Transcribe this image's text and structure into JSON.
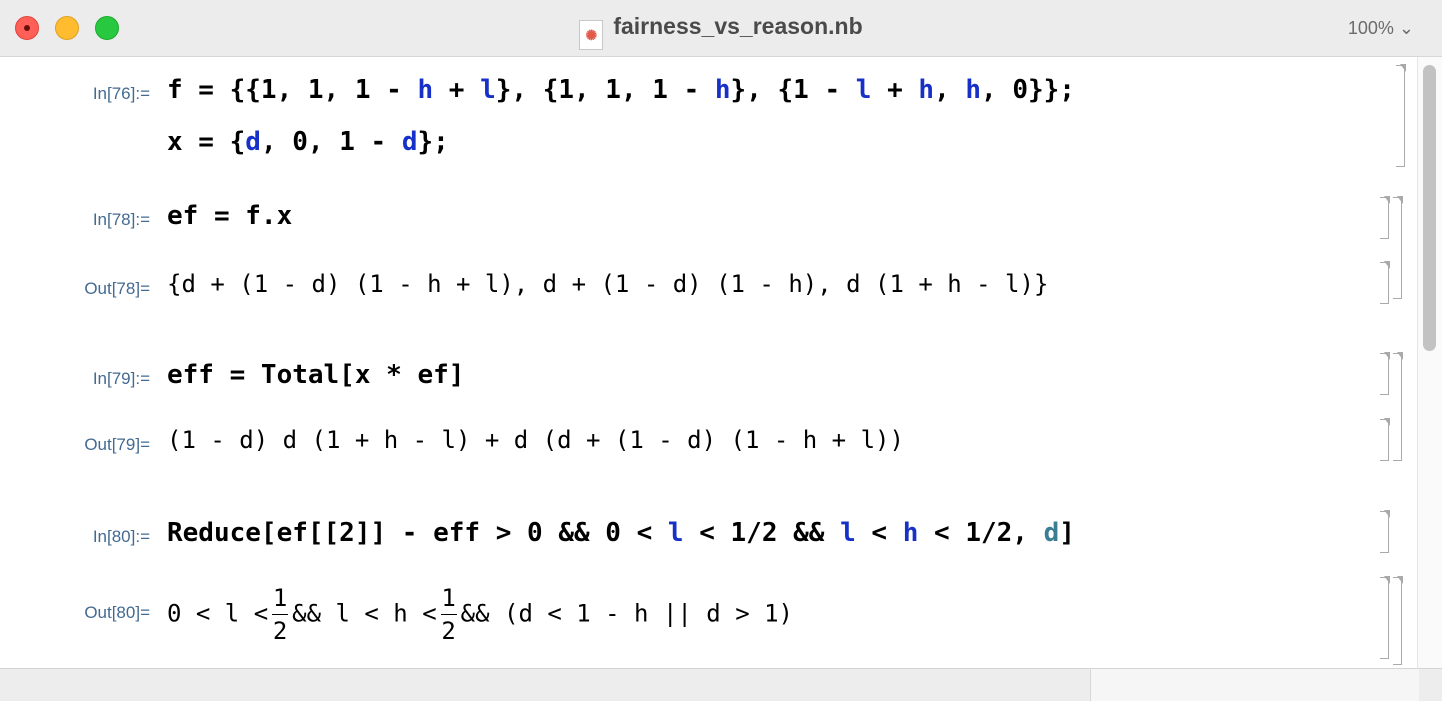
{
  "window": {
    "title": "fairness_vs_reason.nb",
    "zoom": "100%",
    "zoom_chevron": "⌄"
  },
  "cells": [
    {
      "label": "In[76]:=",
      "kind": "in",
      "lines": [
        [
          {
            "t": "f = {{1, 1, 1 - "
          },
          {
            "t": "h",
            "c": "blue"
          },
          {
            "t": " + "
          },
          {
            "t": "l",
            "c": "blue"
          },
          {
            "t": "}, {1, 1, 1 - "
          },
          {
            "t": "h",
            "c": "blue"
          },
          {
            "t": "}, {1 - "
          },
          {
            "t": "l",
            "c": "blue"
          },
          {
            "t": " + "
          },
          {
            "t": "h",
            "c": "blue"
          },
          {
            "t": ", "
          },
          {
            "t": "h",
            "c": "blue"
          },
          {
            "t": ", 0}};"
          }
        ],
        [
          {
            "t": "x = {"
          },
          {
            "t": "d",
            "c": "blue"
          },
          {
            "t": ", 0, 1 - "
          },
          {
            "t": "d",
            "c": "blue"
          },
          {
            "t": "};"
          }
        ]
      ]
    },
    {
      "label": "In[78]:=",
      "kind": "in",
      "lines": [
        [
          {
            "t": "ef = f.x"
          }
        ]
      ]
    },
    {
      "label": "Out[78]=",
      "kind": "out",
      "lines": [
        [
          {
            "t": "{d + (1 - d) (1 - h + l), d + (1 - d) (1 - h), d (1 + h - l)}"
          }
        ]
      ]
    },
    {
      "label": "In[79]:=",
      "kind": "in",
      "lines": [
        [
          {
            "t": "eff = Total[x * ef]"
          }
        ]
      ]
    },
    {
      "label": "Out[79]=",
      "kind": "out",
      "lines": [
        [
          {
            "t": "(1 - d) d (1 + h - l) + d (d + (1 - d) (1 - h + l))"
          }
        ]
      ]
    },
    {
      "label": "In[80]:=",
      "kind": "in",
      "lines": [
        [
          {
            "t": "Reduce[ef[[2]] - eff > 0 && 0 < "
          },
          {
            "t": "l",
            "c": "blue"
          },
          {
            "t": " < 1/2 && "
          },
          {
            "t": "l",
            "c": "blue"
          },
          {
            "t": " < "
          },
          {
            "t": "h",
            "c": "blue"
          },
          {
            "t": " < 1/2, "
          },
          {
            "t": "d",
            "c": "teal"
          },
          {
            "t": "]"
          }
        ]
      ]
    },
    {
      "label": "Out[80]=",
      "kind": "out",
      "lines": [
        [
          {
            "t": "0 < l <"
          },
          {
            "num": "1",
            "den": "2"
          },
          {
            "t": "&& l < h <"
          },
          {
            "num": "1",
            "den": "2"
          },
          {
            "t": "&& (d < 1 - h || d > 1)"
          }
        ]
      ]
    }
  ]
}
